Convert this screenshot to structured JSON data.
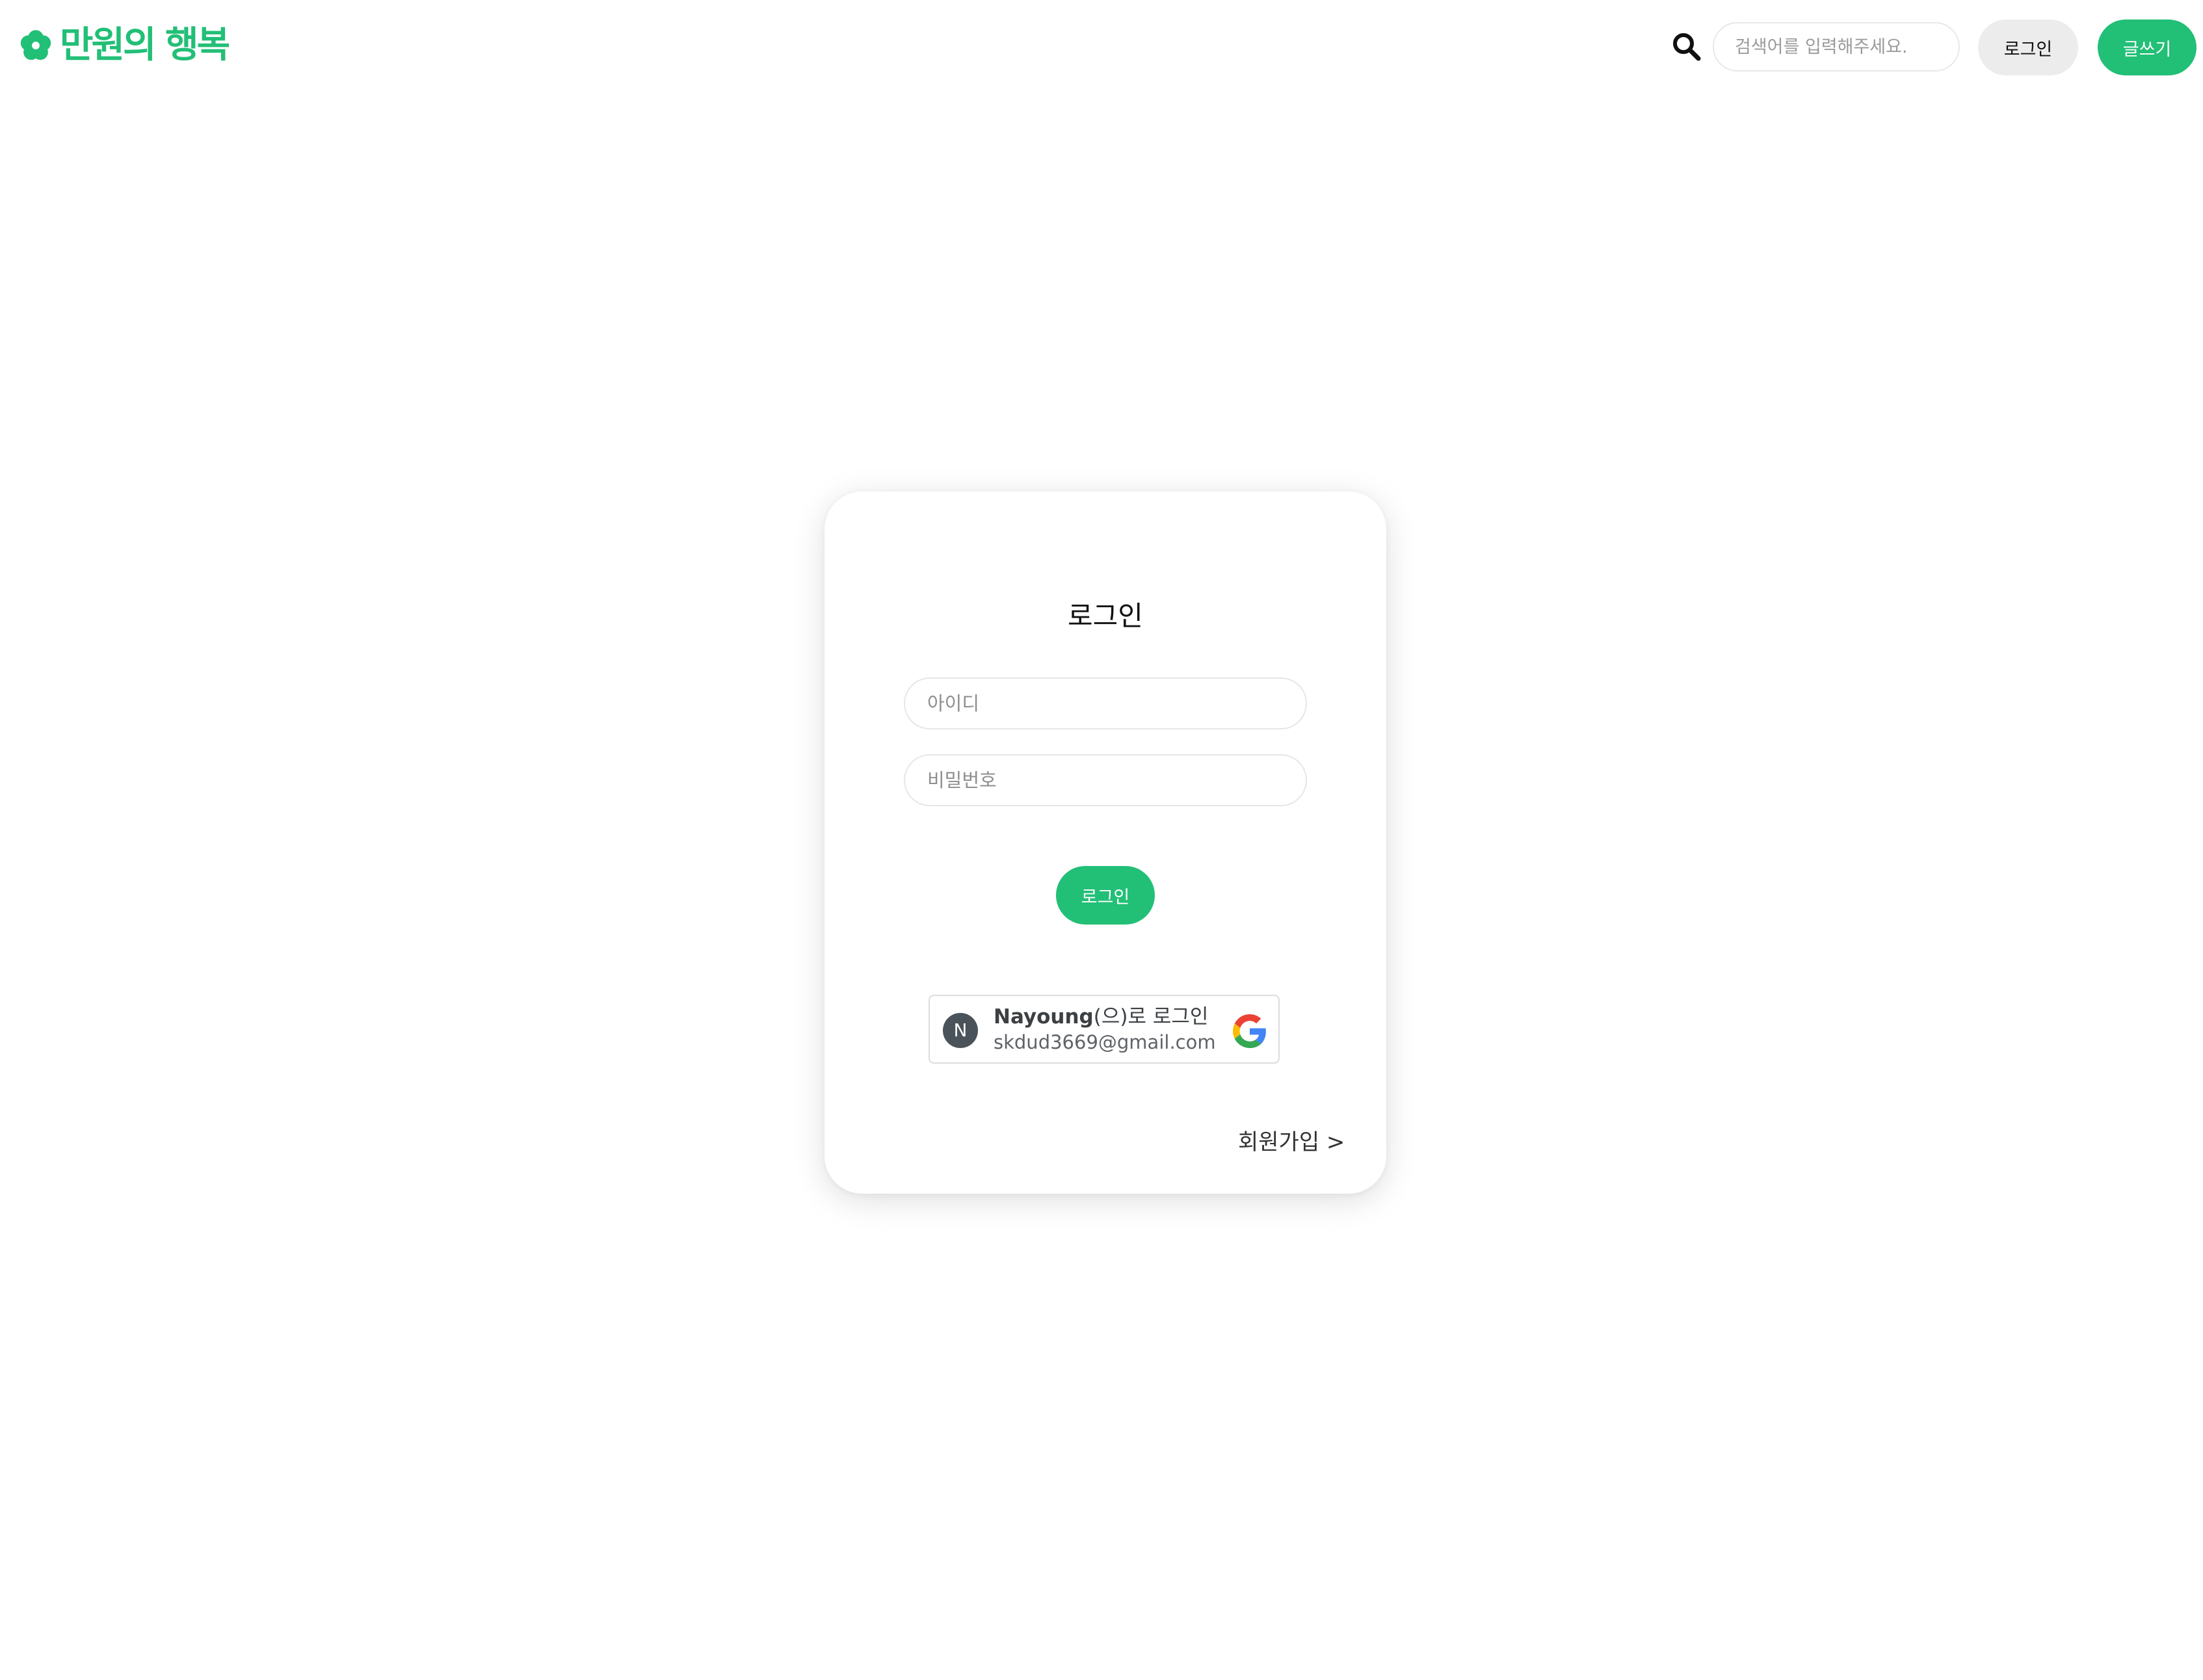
{
  "colors": {
    "brand": "#22bf77",
    "avatar": "#4a525a"
  },
  "header": {
    "logo_icon": "flower-icon",
    "logo_text": "만원의 행복",
    "search_icon": "search-icon",
    "search_placeholder": "검색어를 입력해주세요.",
    "search_value": "",
    "login_label": "로그인",
    "write_label": "글쓰기"
  },
  "login_card": {
    "title": "로그인",
    "id_placeholder": "아이디",
    "id_value": "",
    "password_placeholder": "비밀번호",
    "password_value": "",
    "submit_label": "로그인",
    "google": {
      "avatar_initial": "N",
      "name_bold": "Nayoung",
      "name_suffix": "(으)로 로그인",
      "email": "skdud3669@gmail.com",
      "icon": "google-logo-icon"
    },
    "signup_label": "회원가입 >"
  }
}
